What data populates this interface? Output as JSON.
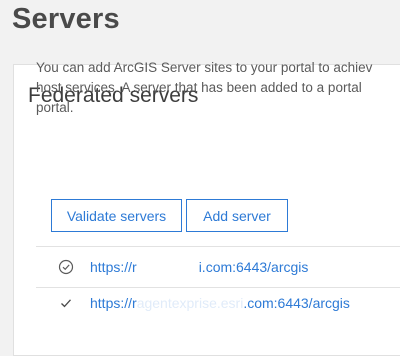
{
  "page": {
    "title": "Servers"
  },
  "federated": {
    "title": "Federated servers",
    "description_lines": [
      "You can add ArcGIS Server sites to your portal to achiev",
      "host services. A server that has been added to a portal",
      "portal."
    ],
    "buttons": {
      "validate": "Validate servers",
      "add": "Add server"
    },
    "servers": [
      {
        "status_icon": "circle-check-icon",
        "url_prefix": "https://r",
        "url_masked": "",
        "url_suffix": "i.com:6443/arcgis"
      },
      {
        "status_icon": "check-icon",
        "url_prefix": "https://r",
        "url_masked": "agentexprise.esri",
        "url_suffix": ".com:6443/arcgis"
      }
    ]
  },
  "colors": {
    "accent": "#2d7ad6",
    "background": "#f2f2f2",
    "card": "#ffffff"
  }
}
